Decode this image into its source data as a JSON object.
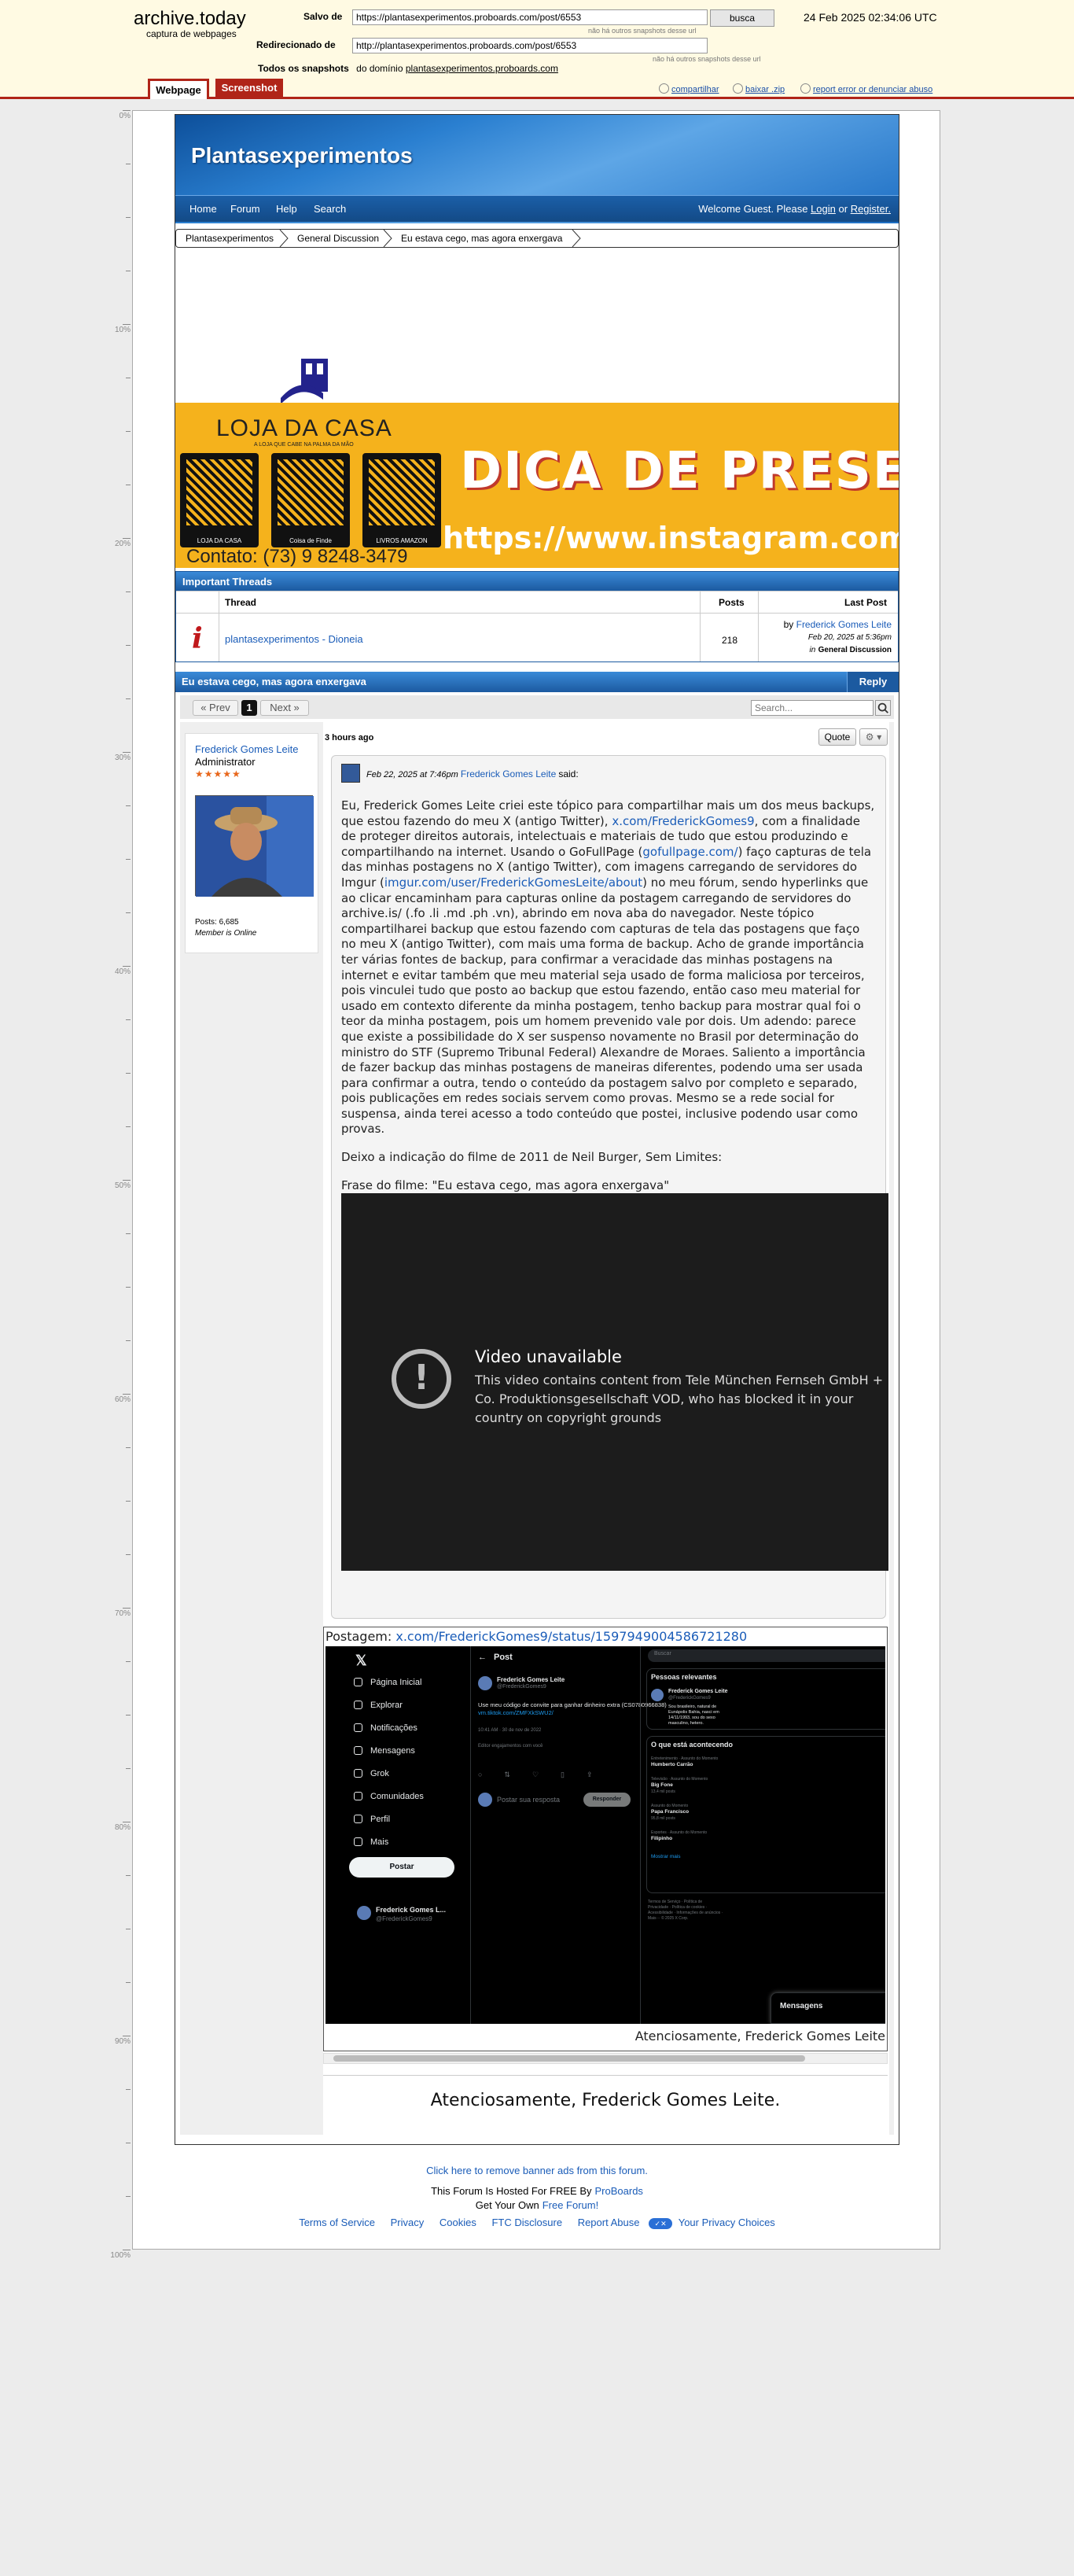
{
  "archive": {
    "logo": "archive.today",
    "subtitle": "captura de webpages",
    "saved_label": "Salvo de",
    "saved_url": "https://plantasexperimentos.proboards.com/post/6553",
    "saved_note": "não há outros snapshots desse url",
    "redirect_label": "Redirecionado de",
    "redirect_url": "http://plantasexperimentos.proboards.com/post/6553",
    "redirect_note": "não há outros snapshots desse url",
    "search_button": "busca",
    "date": "24 Feb 2025 02:34:06 UTC",
    "domain_label": "Todos os snapshots",
    "domain_prefix": "do domínio",
    "domain_link": "plantasexperimentos.proboards.com",
    "tabs": [
      "Webpage",
      "Screenshot"
    ],
    "actions": [
      "compartilhar",
      "baixar .zip",
      "report error or denunciar abuso"
    ]
  },
  "ruler": [
    "0%",
    "10%",
    "20%",
    "30%",
    "40%",
    "50%",
    "60%",
    "70%",
    "80%",
    "90%",
    "100%"
  ],
  "forum": {
    "title": "Plantasexperimentos",
    "nav": [
      "Home",
      "Forum",
      "Help",
      "Search"
    ],
    "welcome_text": "Welcome Guest. Please",
    "login": "Login",
    "or": "or",
    "register": "Register.",
    "breadcrumb": [
      "Plantasexperimentos",
      "General Discussion",
      "Eu estava cego, mas agora enxergava"
    ]
  },
  "ad": {
    "store_name": "LOJA DA CASA",
    "store_tagline": "A LOJA QUE CABE NA PALMA DA MÃO",
    "qr_captions": [
      "LOJA DA CASA",
      "Coisa de Finde",
      "LIVROS AMAZON"
    ],
    "headline": "DICA DE PRESENTE",
    "instagram": "https://www.instagram.com/lo",
    "contact": "Contato: (73) 9 8248-3479"
  },
  "important_threads": {
    "title": "Important Threads",
    "columns": [
      "Thread",
      "Posts",
      "Last Post"
    ],
    "rows": [
      {
        "thread": "plantasexperimentos - Dioneia",
        "posts": "218",
        "last_by_prefix": "by",
        "last_by": "Frederick Gomes Leite",
        "last_date": "Feb 20, 2025 at 5:36pm",
        "last_in_prefix": "in",
        "last_in": "General Discussion"
      }
    ]
  },
  "thread": {
    "title": "Eu estava cego, mas agora enxergava",
    "reply": "Reply",
    "prev": "« Prev",
    "page": "1",
    "next": "Next »",
    "search_placeholder": "Search..."
  },
  "post": {
    "author": "Frederick Gomes Leite",
    "role": "Administrator",
    "stars": "★★★★★",
    "posts_count": "Posts: 6,685",
    "online": "Member is Online",
    "time": "3 hours ago",
    "quote_button": "Quote",
    "quote_date": "Feb 22, 2025 at 7:46pm",
    "quote_author": "Frederick Gomes Leite",
    "quote_said": "said:",
    "paragraph1_a": "Eu, Frederick Gomes Leite criei este tópico para compartilhar mais um dos meus backups, que estou fazendo do meu X (antigo Twitter), ",
    "link1": "x.com/FrederickGomes9",
    "paragraph1_b": ", com a finalidade de proteger direitos autorais, intelectuais e materiais de tudo que estou produzindo e compartilhando na internet. Usando o GoFullPage (",
    "link2": "gofullpage.com/",
    "paragraph1_c": ") faço capturas de tela das minhas postagens no X (antigo Twitter), com imagens carregando de servidores do Imgur (",
    "link3": "imgur.com/user/FrederickGomesLeite/about",
    "paragraph1_d": ") no meu fórum, sendo hyperlinks que ao clicar encaminham para capturas online da postagem carregando de servidores do archive.is/ (.fo .li .md .ph .vn), abrindo em nova aba do navegador. Neste tópico compartilharei backup que estou fazendo com capturas de tela das postagens que faço no meu X (antigo Twitter), com mais uma forma de backup. Acho de grande importância ter várias fontes de backup, para confirmar a veracidade das minhas postagens na internet e evitar também que meu material seja usado de forma maliciosa por terceiros, pois vinculei tudo que posto ao backup que estou fazendo, então caso meu material for usado em contexto diferente da minha postagem, tenho backup para mostrar qual foi o teor da minha postagem, pois um homem prevenido vale por dois. Um adendo: parece que existe a possibilidade do X ser suspenso novamente no Brasil por determinação do ministro do STF (Supremo Tribunal Federal) Alexandre de Moraes. Saliento a importância de fazer backup das minhas postagens de maneiras diferentes, podendo uma ser usada para confirmar a outra, tendo o conteúdo da postagem salvo por completo e separado, pois publicações em redes sociais servem como provas. Mesmo se a rede social for suspensa, ainda terei acesso a todo conteúdo que postei, inclusive podendo usar como provas.",
    "paragraph2": "Deixo a indicação do filme de 2011 de Neil Burger, Sem Limites:",
    "paragraph3": "Frase do filme: \"Eu estava cego, mas agora enxergava\"",
    "video_title": "Video unavailable",
    "video_message": "This video contains content from Tele München Fernseh GmbH + Co. Produktionsgesellschaft VOD, who has blocked it in your country on copyright grounds",
    "tweet_label_prefix": "Postagem:",
    "tweet_link": "x.com/FrederickGomes9/status/1597949004586721280",
    "tweet_signature": "Atenciosamente, Frederick Gomes Leite",
    "signature": "Atenciosamente, Frederick Gomes Leite."
  },
  "x_screenshot": {
    "nav": [
      "Página Inicial",
      "Explorar",
      "Notificações",
      "Mensagens",
      "Grok",
      "Comunidades",
      "Perfil",
      "Mais"
    ],
    "post_button": "Postar",
    "account_name": "Frederick Gomes L...",
    "account_handle": "@FrederickGomes9",
    "header": "Post",
    "tweet_name": "Frederick Gomes Leite",
    "tweet_handle": "@FrederickGomes9",
    "tweet_text": "Use meu código de convite para ganhar dinheiro extra (CS0780966838)",
    "tweet_link": "vm.tiktok.com/ZMFXkSWU2/",
    "tweet_time": "10:41 AM · 30 de nov de 2022",
    "tweet_edit": "Editor engajamentos com você",
    "reply_placeholder": "Postar sua resposta",
    "reply_button": "Responder",
    "search": "Buscar",
    "relevant_title": "Pessoas relevantes",
    "relevant_name": "Frederick Gomes Leite",
    "relevant_handle": "@FrederickGomes9",
    "relevant_bio": "Sou brasileiro, natural de Eunápolis Bahia, nasci em 14/11/1993, sou do sexo masculino, hetero.",
    "happening_title": "O que está acontecendo",
    "trends": [
      {
        "meta": "Entretenimento · Assunto do Momento",
        "name": "Humberto Carrão"
      },
      {
        "meta": "Televisão · Assunto do Momento",
        "name": "Big Fone",
        "count": "13,4 mil posts"
      },
      {
        "meta": "Assunto do Momento",
        "name": "Papa Francisco",
        "count": "95,8 mil posts"
      },
      {
        "meta": "Esportes · Assunto do Momento",
        "name": "Filipinho"
      }
    ],
    "show_more": "Mostrar mais",
    "footer_links": "Termos de Serviço · Política de Privacidade · Política de cookies · Acessibilidade · Informações de anúncios · Mais··· © 2025 X Corp.",
    "messages": "Mensagens"
  },
  "footer": {
    "remove_ads": "Click here to remove banner ads from this forum.",
    "hosted_prefix": "This Forum Is Hosted For FREE By",
    "hosted_link": "ProBoards",
    "get_prefix": "Get Your Own",
    "get_link": "Free Forum!",
    "links": [
      "Terms of Service",
      "Privacy",
      "Cookies",
      "FTC Disclosure",
      "Report Abuse",
      "Your Privacy Choices"
    ]
  },
  "colors": {
    "archive_red": "#b02418",
    "forum_blue": "#1c5aa0",
    "link_blue": "#1a5cb8",
    "ad_yellow": "#f5b21c"
  }
}
